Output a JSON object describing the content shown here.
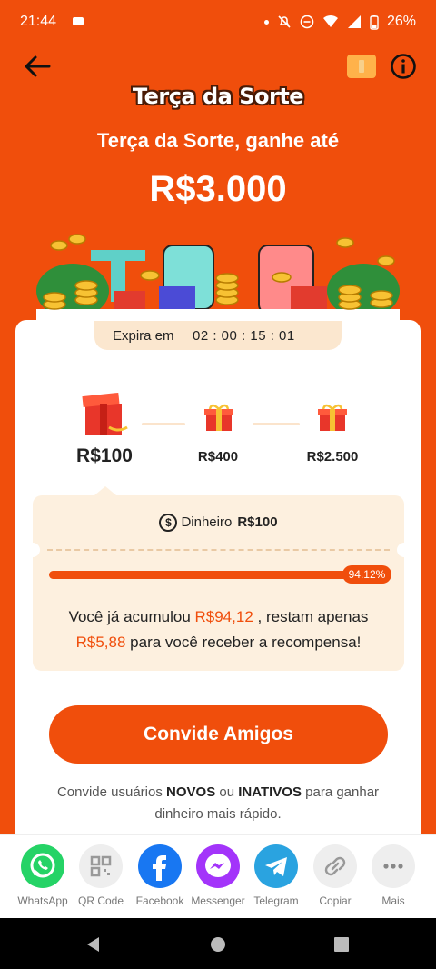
{
  "status_bar": {
    "time": "21:44",
    "battery": "26%"
  },
  "header": {
    "brand": "Terça da Sorte"
  },
  "hero": {
    "subtitle": "Terça da Sorte, ganhe até",
    "amount": "R$3.000"
  },
  "expire": {
    "label": "Expira em",
    "countdown": "02 : 00 : 15 : 01"
  },
  "tiers": [
    {
      "amount": "R$100"
    },
    {
      "amount": "R$400"
    },
    {
      "amount": "R$2.500"
    }
  ],
  "panel": {
    "cash_label": "Dinheiro",
    "cash_value": "R$100",
    "progress_label": "94.12%",
    "progress_fraction": 0.9412,
    "msg_a": "Você já acumulou ",
    "msg_accum": "R$94,12",
    "msg_b": " , restam apenas",
    "msg_remain": "R$5,88",
    "msg_c": " para você receber a recompensa!"
  },
  "cta": {
    "label": "Convide Amigos"
  },
  "note": {
    "a": "Convide usuários ",
    "novos": "NOVOS",
    "b": " ou ",
    "inativos": "INATIVOS",
    "c": " para ganhar dinheiro mais rápido."
  },
  "share": [
    {
      "label": "WhatsApp",
      "color": "#25d366",
      "icon": "whatsapp-icon"
    },
    {
      "label": "QR Code",
      "color": "#eeeeee",
      "icon": "qr-code-icon"
    },
    {
      "label": "Facebook",
      "color": "#1877f2",
      "icon": "facebook-icon"
    },
    {
      "label": "Messenger",
      "color": "#a334fa",
      "icon": "messenger-icon"
    },
    {
      "label": "Telegram",
      "color": "#2aa3e0",
      "icon": "telegram-icon"
    },
    {
      "label": "Copiar",
      "color": "#eeeeee",
      "icon": "link-icon"
    },
    {
      "label": "Mais",
      "color": "#eeeeee",
      "icon": "more-icon"
    }
  ],
  "colors": {
    "accent": "#f04e0c",
    "panel": "#fdf0df"
  }
}
